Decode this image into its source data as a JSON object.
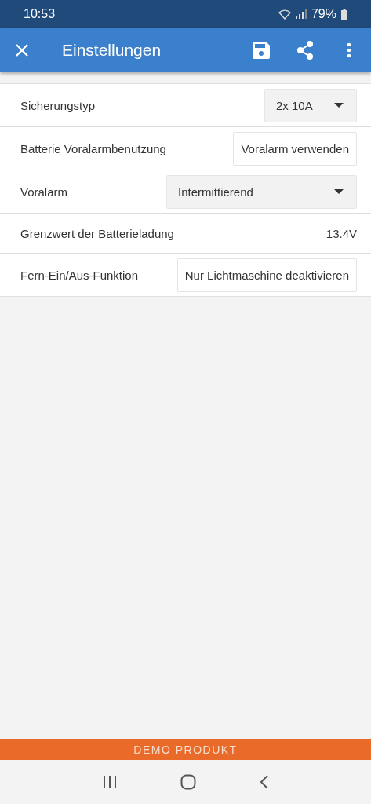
{
  "status_bar": {
    "time": "10:53",
    "battery": "79%"
  },
  "app_bar": {
    "title": "Einstellungen"
  },
  "settings": [
    {
      "label": "Sicherungstyp",
      "kind": "dropdown",
      "value": "2x 10A"
    },
    {
      "label": "Batterie Voralarmbenutzung",
      "kind": "button",
      "value": "Voralarm verwenden"
    },
    {
      "label": "Voralarm",
      "kind": "dropdown",
      "value": "Intermittierend"
    },
    {
      "label": "Grenzwert der Batterieladung",
      "kind": "value",
      "value": "13.4V"
    },
    {
      "label": "Fern-Ein/Aus-Funktion",
      "kind": "button",
      "value": "Nur Lichtmaschine deaktivieren"
    }
  ],
  "banner": "DEMO PRODUKT"
}
